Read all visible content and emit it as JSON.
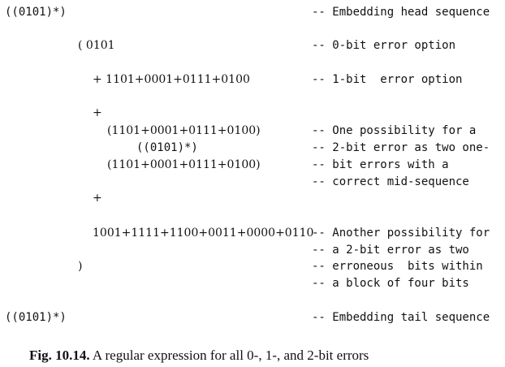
{
  "lines": {
    "head_expr": "((0101)*)",
    "head_comment": "-- Embedding head sequence",
    "open_expr": "( 0101",
    "open_comment": "-- 0-bit error option",
    "onebit_expr": "+ 1101+0001+0111+0100",
    "onebit_comment": "-- 1-bit  error option",
    "plus1": "+",
    "two_a_expr": "(1101+0001+0111+0100)",
    "two_a_comment": "-- One possibility for a",
    "two_b_expr": "((0101)*)",
    "two_b_comment": "-- 2-bit error as two one-",
    "two_c_expr": "(1101+0001+0111+0100)",
    "two_c_comment": "-- bit errors with a",
    "two_d_comment": "-- correct mid-sequence",
    "plus2": "+",
    "four_expr": "1001+1111+1100+0011+0000+0110",
    "four_comment_a": "-- Another possibility for",
    "four_comment_b": "-- a 2-bit error as two",
    "close_expr": ")",
    "four_comment_c": "-- erroneous  bits within",
    "four_comment_d": "-- a block of four bits",
    "tail_expr": "((0101)*)",
    "tail_comment": "-- Embedding tail sequence"
  },
  "caption": {
    "label": "Fig. 10.14.",
    "text": " A regular expression for all 0-, 1-, and 2-bit errors"
  }
}
